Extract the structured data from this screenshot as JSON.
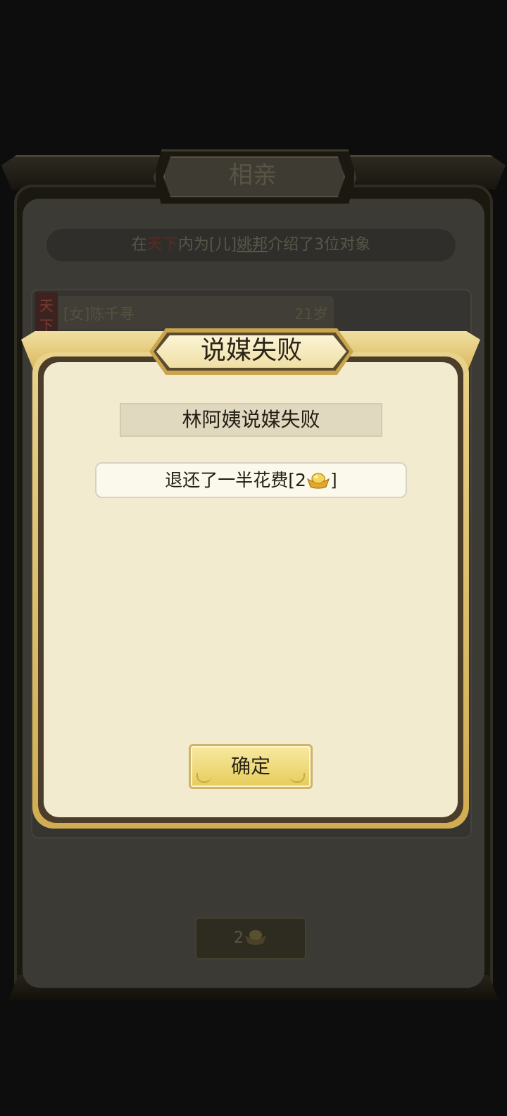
{
  "background": {
    "title": "相亲",
    "info": {
      "prefix": "在",
      "region": "天下",
      "mid": "内为[儿]",
      "child_name": "姚邦",
      "suffix": "介绍了3位对象"
    },
    "candidate": {
      "tag": "天下",
      "name": "[女]陈千寻",
      "age": "21岁"
    },
    "cost_button": {
      "amount": "2",
      "currency_icon": "gold-ingot-icon"
    }
  },
  "dialog": {
    "title": "说媒失败",
    "message": "林阿姨说媒失败",
    "refund": {
      "text_before": "退还了一半花费[2",
      "text_after": "]",
      "currency_icon": "gold-ingot-icon"
    },
    "confirm_label": "确定"
  },
  "colors": {
    "dialog_body": "#f2ebd0",
    "gold_frame": "#d8b457",
    "button_gold": "#e7cc5a",
    "overlay_dark": "#0d0d0d"
  }
}
